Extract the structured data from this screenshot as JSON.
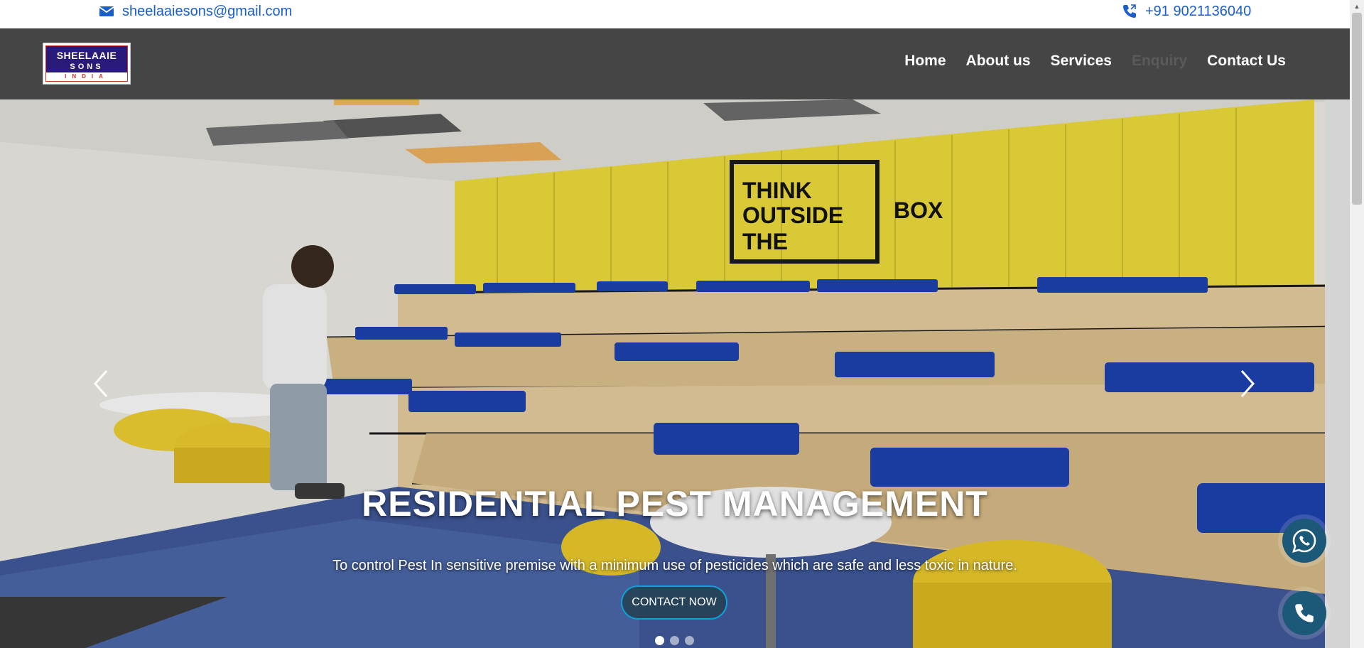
{
  "topbar": {
    "email": "sheelaaiesons@gmail.com",
    "phone": "+91 9021136040",
    "email_icon": "mail-icon",
    "phone_icon": "phone-icon"
  },
  "logo": {
    "line1": "SHEELAAIE",
    "line2": "SONS",
    "line3": "INDIA"
  },
  "nav": {
    "items": [
      {
        "label": "Home"
      },
      {
        "label": "About us"
      },
      {
        "label": "Services"
      },
      {
        "label": "Enquiry",
        "active": true
      },
      {
        "label": "Contact Us"
      }
    ]
  },
  "hero": {
    "title": "RESIDENTIAL PEST MANAGEMENT",
    "subtitle": "To control Pest In sensitive premise with a minimum use of pesticides which are safe and less toxic in nature.",
    "cta_label": "CONTACT NOW",
    "sign_line1": "THINK",
    "sign_line2": "OUTSIDE",
    "sign_line3": "THE",
    "sign_line4": "BOX",
    "slides": 3,
    "active_slide": 1
  },
  "colors": {
    "link_blue": "#1a5fc9",
    "nav_bg": "#454545",
    "cta_border": "#0f9fd8",
    "float_btn": "#1c5878"
  }
}
